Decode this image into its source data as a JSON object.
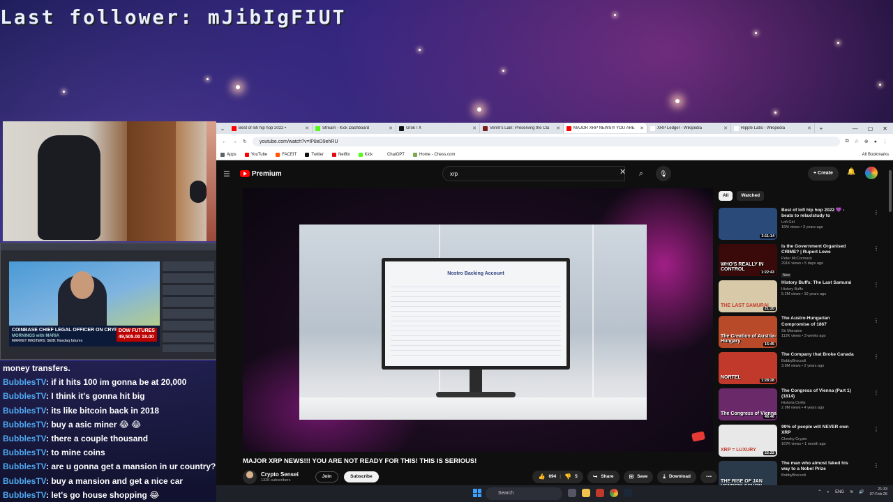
{
  "overlay": {
    "last_follower": "Last follower: mJibIgFIUT"
  },
  "tv": {
    "headline": "COINBASE CHIEF LEGAL OFFICER ON CRYPTO REWARDS",
    "show": "MORNINGS with MARIA",
    "dow_label": "DOW FUTURES",
    "dow_value": "49,505.00",
    "dow_change": "18.00",
    "ticker": "MARKET MASTERS: SEIB: Nasdaq futures"
  },
  "chat": {
    "header": "money transfers.",
    "messages": [
      {
        "user": "BubblesTV",
        "text": ": if it hits 100 im gonna be at 20,000"
      },
      {
        "user": "BubblesTV",
        "text": ": I think it's gonna hit big"
      },
      {
        "user": "BubblesTV",
        "text": ": its like bitcoin back in 2018"
      },
      {
        "user": "BubblesTV",
        "text": ": buy a asic miner 😂 😂"
      },
      {
        "user": "BubblesTV",
        "text": ": there a couple thousand"
      },
      {
        "user": "BubblesTV",
        "text": ": to mine coins"
      },
      {
        "user": "BubblesTV",
        "text": ": are u gonna get a mansion in ur country?"
      },
      {
        "user": "BubblesTV",
        "text": ": buy a mansion and get a nice car"
      },
      {
        "user": "BubblesTV",
        "text": ": let's go house shopping 😂"
      }
    ]
  },
  "browser": {
    "tabs": [
      {
        "title": "Best of lofi hip hop 2022 •",
        "color": "#ff0000"
      },
      {
        "title": "Stream - Kick Dashboard",
        "color": "#53fc18"
      },
      {
        "title": "Grok / X",
        "color": "#111111"
      },
      {
        "title": "Venm's Lain: Preserving the Cla",
        "color": "#7a1c1c"
      },
      {
        "title": "MAJOR XRP NEWS!!! YOU ARE",
        "color": "#ff0000"
      },
      {
        "title": "XRP Ledger - Wikipedia",
        "color": "#ffffff"
      },
      {
        "title": "Ripple Labs - Wikipedia",
        "color": "#ffffff"
      }
    ],
    "active_tab": 4,
    "url": "youtube.com/watch?v=lP8eD9ehRU",
    "bookmarks": [
      {
        "label": "Apps",
        "color": "#5f6368"
      },
      {
        "label": "YouTube",
        "color": "#ff0000"
      },
      {
        "label": "FACEIT",
        "color": "#ff5500"
      },
      {
        "label": "Twitter",
        "color": "#111111"
      },
      {
        "label": "Netflix",
        "color": "#e50914"
      },
      {
        "label": "Kick",
        "color": "#53fc18"
      },
      {
        "label": "ChatGPT",
        "color": "#ffffff"
      },
      {
        "label": "Home - Chess.com",
        "color": "#7fa650"
      }
    ],
    "all_bookmarks": "All Bookmarks"
  },
  "youtube": {
    "logo": "Premium",
    "search_value": "xrp",
    "create": "Create",
    "video_title": "MAJOR XRP NEWS!!! YOU ARE NOT READY FOR THIS! THIS IS SERIOUS!",
    "screen_title": "Nostro Backing Account",
    "channel": "Crypto Sensei",
    "subscribers": "132K subscribers",
    "join": "Join",
    "subscribe": "Subscribe",
    "likes": "694",
    "dislikes": "5",
    "share": "Share",
    "save": "Save",
    "download": "Download",
    "chips": [
      "All",
      "Watched"
    ],
    "recommendations": [
      {
        "title": "Best of lofi hip hop 2022 💜 - beats to relax/study to",
        "channel": "Lofi Girl",
        "views": "16M views • 3 years ago",
        "duration": "3:11:14",
        "thumb": "#2a4a7a",
        "cap": "",
        "badge": ""
      },
      {
        "title": "Is the Government Organised CRIME? | Rupert Lowe",
        "channel": "Peter McCormack",
        "views": "291K views • 5 days ago",
        "duration": "1:22:43",
        "thumb": "#3a0a0a",
        "cap": "WHO'S REALLY IN CONTROL",
        "badge": "New"
      },
      {
        "title": "History Buffs: The Last Samurai",
        "channel": "History Buffs",
        "views": "5.2M views • 10 years ago",
        "duration": "21:20",
        "thumb": "#d8c9a8",
        "cap": "THE LAST SAMURAI",
        "badge": ""
      },
      {
        "title": "The Austro-Hungarian Compromise of 1867",
        "channel": "Sir Manatee",
        "views": "112K views • 3 weeks ago",
        "duration": "15:45",
        "thumb": "#b84a2a",
        "cap": "The Creation of Austria-Hungary",
        "badge": ""
      },
      {
        "title": "The Company that Broke Canada",
        "channel": "BobbyBroccoli",
        "views": "3.8M views • 2 years ago",
        "duration": "1:28:28",
        "thumb": "#c0392b",
        "cap": "NORTEL",
        "badge": ""
      },
      {
        "title": "The Congress of Vienna (Part 1) (1814)",
        "channel": "Historia Civilis",
        "views": "2.9M views • 4 years ago",
        "duration": "46:46",
        "thumb": "#6a2a6a",
        "cap": "The Congress of Vienna",
        "badge": ""
      },
      {
        "title": "99% of people will NEVER own XRP",
        "channel": "Cheeky Crypto",
        "views": "167K views • 1 month ago",
        "duration": "22:22",
        "thumb": "#e8e8e8",
        "cap": "XRP = LUXURY",
        "badge": ""
      },
      {
        "title": "The man who almost faked his way to a Nobel Prize",
        "channel": "BobbyBroccoli",
        "views": "",
        "duration": "",
        "thumb": "#2a3a4a",
        "cap": "THE RISE OF JAN HENDRIK SCHÖN",
        "badge": ""
      }
    ]
  },
  "taskbar": {
    "search": "Search",
    "lang": "ENG",
    "time": "21:33",
    "date": "07-Feb-26"
  }
}
